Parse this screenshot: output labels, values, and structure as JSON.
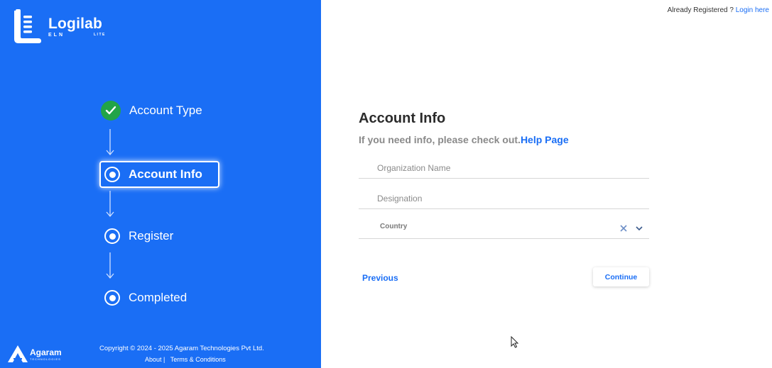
{
  "app": {
    "logo_text": "Logilab",
    "logo_sub": "ELN",
    "logo_edition": "LITE"
  },
  "steps": [
    {
      "label": "Account Type",
      "state": "completed"
    },
    {
      "label": "Account Info",
      "state": "active"
    },
    {
      "label": "Register",
      "state": "pending"
    },
    {
      "label": "Completed",
      "state": "pending"
    }
  ],
  "footer": {
    "brand": "Agaram",
    "brand_tagline": "TECHNOLOGIES",
    "copyright": "Copyright © 2024 - 2025 Agaram Technologies Pvt Ltd.",
    "about": "About |",
    "terms": "Terms & Conditions"
  },
  "header": {
    "already_text": "Already Registered ?",
    "login_link": "Login here"
  },
  "form": {
    "title": "Account Info",
    "subtitle": "If you need info, please check out.",
    "help_link": "Help Page",
    "organization_placeholder": "Organization Name",
    "designation_placeholder": "Designation",
    "country_label": "Country",
    "previous_label": "Previous",
    "continue_label": "Continue"
  },
  "colors": {
    "primary": "#1a6ef5",
    "success": "#22a447"
  }
}
